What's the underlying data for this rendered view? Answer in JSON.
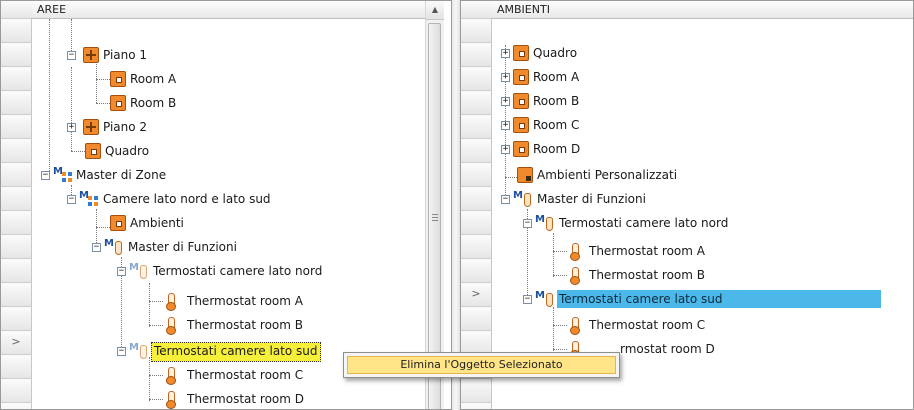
{
  "left_panel": {
    "header": "AREE",
    "gutter_marker": ">",
    "rows": [
      {
        "label": "Piano 1",
        "icon": "piano-icon"
      },
      {
        "label": "Room A",
        "icon": "room-icon"
      },
      {
        "label": "Room B",
        "icon": "room-icon"
      },
      {
        "label": "Piano 2",
        "icon": "piano-icon"
      },
      {
        "label": "Quadro",
        "icon": "room-icon"
      },
      {
        "label": "Master di Zone",
        "icon": "master-zone-icon"
      },
      {
        "label": "Camere lato nord e lato sud",
        "icon": "master-zone-icon"
      },
      {
        "label": "Ambienti",
        "icon": "room-icon"
      },
      {
        "label": "Master di Funzioni",
        "icon": "master-function-icon"
      },
      {
        "label": "Termostati camere lato nord",
        "icon": "master-function-icon"
      },
      {
        "label": "Thermostat room A",
        "icon": "thermostat-icon"
      },
      {
        "label": "Thermostat room B",
        "icon": "thermostat-icon"
      },
      {
        "label": "Termostati camere lato sud",
        "icon": "master-function-icon",
        "selected": true
      },
      {
        "label": "Thermostat room C",
        "icon": "thermostat-icon"
      },
      {
        "label": "Thermostat room D",
        "icon": "thermostat-icon"
      }
    ]
  },
  "right_panel": {
    "header": "AMBIENTI",
    "gutter_marker": ">",
    "rows": [
      {
        "label": "Quadro",
        "icon": "room-icon"
      },
      {
        "label": "Room A",
        "icon": "room-icon"
      },
      {
        "label": "Room B",
        "icon": "room-icon"
      },
      {
        "label": "Room C",
        "icon": "room-icon"
      },
      {
        "label": "Room D",
        "icon": "room-icon"
      },
      {
        "label": "Ambienti Personalizzati",
        "icon": "custom-room-icon"
      },
      {
        "label": "Master di Funzioni",
        "icon": "master-function-icon"
      },
      {
        "label": "Termostati camere lato nord",
        "icon": "master-function-icon"
      },
      {
        "label": "Thermostat room A",
        "icon": "thermostat-icon"
      },
      {
        "label": "Thermostat room B",
        "icon": "thermostat-icon"
      },
      {
        "label": "Termostati camere lato sud",
        "icon": "master-function-icon",
        "selected": true
      },
      {
        "label": "Thermostat room C",
        "icon": "thermostat-icon"
      },
      {
        "label": "rmostat room D",
        "icon": "thermostat-icon"
      }
    ]
  },
  "context_menu": {
    "items": [
      {
        "label": "Elimina l'Oggetto Selezionato"
      }
    ]
  },
  "scrollbar": {
    "up_arrow": "▲"
  },
  "colors": {
    "selection_yellow": "#f7f03a",
    "selection_blue": "#4cb8ea",
    "menu_highlight": "#ffe488",
    "room_orange": "#f08a2c"
  }
}
